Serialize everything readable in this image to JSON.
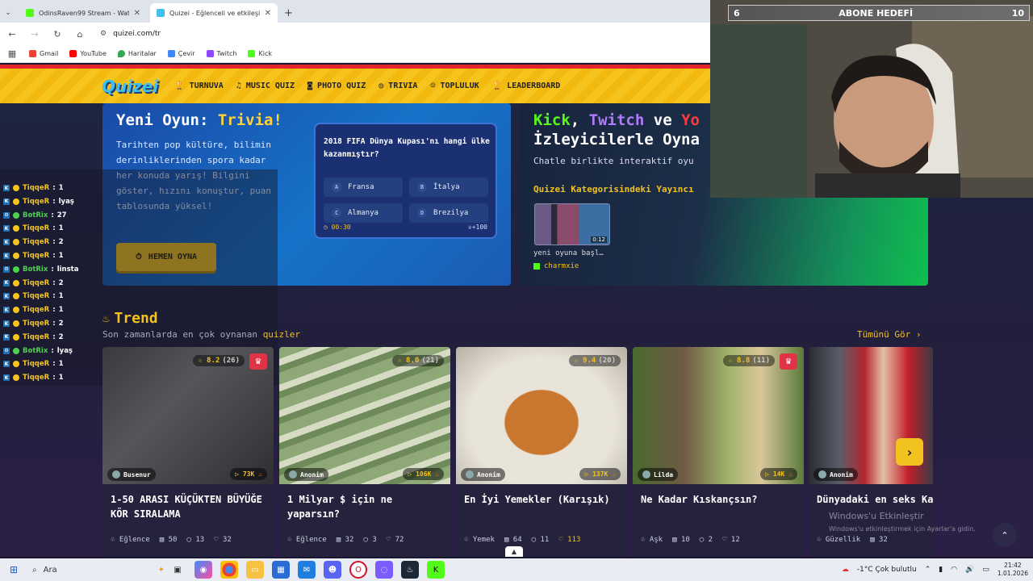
{
  "browser": {
    "tabs": [
      {
        "title": "OdinsRaven99 Stream - Watch",
        "favicon_color": "#53fc18",
        "active": false
      },
      {
        "title": "Quizei - Eğlenceli ve etkileşimli",
        "favicon_color": "#3ec1f0",
        "active": true
      }
    ],
    "url": "quizei.com/tr",
    "bookmarks": [
      {
        "label": "Gmail",
        "color": "#ea4335"
      },
      {
        "label": "YouTube",
        "color": "#ff0000"
      },
      {
        "label": "Haritalar",
        "color": "#34a853"
      },
      {
        "label": "Çevir",
        "color": "#4285f4"
      },
      {
        "label": "Twitch",
        "color": "#9146ff"
      },
      {
        "label": "Kick",
        "color": "#53fc18"
      }
    ]
  },
  "site": {
    "logo": "Quizei",
    "nav": [
      {
        "label": "TURNUVA",
        "icon": "trophy-icon"
      },
      {
        "label": "MUSIC QUIZ",
        "icon": "music-icon"
      },
      {
        "label": "PHOTO QUIZ",
        "icon": "camera-icon"
      },
      {
        "label": "TRIVIA",
        "icon": "chat-icon"
      },
      {
        "label": "TOPLULUK",
        "icon": "users-icon"
      },
      {
        "label": "LEADERBOARD",
        "icon": "trophy-icon"
      }
    ]
  },
  "hero_trivia": {
    "title_prefix": "Yeni Oyun:",
    "title_highlight": "Trivia!",
    "description": "Tarihten pop kültüre, bilimin derinliklerinden spora kadar her konuda yarış! Bilgini göster, hızını konuştur, puan tablosunda yüksel!",
    "play_button": "HEMEN OYNA",
    "question": "2018 FIFA Dünya Kupası'nı hangi ülke kazanmıştır?",
    "options": [
      {
        "key": "A",
        "label": "Fransa"
      },
      {
        "key": "B",
        "label": "İtalya"
      },
      {
        "key": "C",
        "label": "Almanya"
      },
      {
        "key": "D",
        "label": "Brezilya"
      }
    ],
    "timer": "00:30",
    "points": "+100"
  },
  "hero_stream": {
    "line1_kick": "Kick",
    "line1_sep1": ",",
    "line1_twitch": "Twitch",
    "line1_ve": "ve",
    "line1_yo": "Yo",
    "line2": "İzleyicilerle Oyna",
    "subtitle": "Chatle birlikte interaktif oyu",
    "category_title": "Quizei Kategorisindeki Yayıncı",
    "video_title": "yeni oyuna başl…",
    "video_duration": "0:12",
    "channel": "charmxie",
    "colors": {
      "kick": "#53fc18",
      "twitch": "#b07aff",
      "youtube": "#ff3b3b"
    }
  },
  "chat": [
    {
      "platform": "kick",
      "name": "TiqqeR",
      "msg": "1"
    },
    {
      "platform": "kick",
      "name": "TiqqeR",
      "msg": "lyaş"
    },
    {
      "platform": "bot",
      "name": "BotRix",
      "msg": "27"
    },
    {
      "platform": "kick",
      "name": "TiqqeR",
      "msg": "1"
    },
    {
      "platform": "kick",
      "name": "TiqqeR",
      "msg": "2"
    },
    {
      "platform": "kick",
      "name": "TiqqeR",
      "msg": "1"
    },
    {
      "platform": "bot",
      "name": "BotRix",
      "msg": "linsta"
    },
    {
      "platform": "kick",
      "name": "TiqqeR",
      "msg": "2"
    },
    {
      "platform": "kick",
      "name": "TiqqeR",
      "msg": "1"
    },
    {
      "platform": "kick",
      "name": "TiqqeR",
      "msg": "1"
    },
    {
      "platform": "kick",
      "name": "TiqqeR",
      "msg": "2"
    },
    {
      "platform": "kick",
      "name": "TiqqeR",
      "msg": "2"
    },
    {
      "platform": "bot",
      "name": "BotRix",
      "msg": "lyaş"
    },
    {
      "platform": "kick",
      "name": "TiqqeR",
      "msg": "1"
    },
    {
      "platform": "kick",
      "name": "TiqqeR",
      "msg": "1"
    }
  ],
  "trend": {
    "title": "Trend",
    "subtitle_prefix": "Son zamanlarda en çok oynanan",
    "subtitle_highlight": "quizler",
    "see_all": "Tümünü Gör ›",
    "cards": [
      {
        "rating": "8.2",
        "votes": "(26)",
        "crown": true,
        "author": "Busenur",
        "plays": "73K",
        "title": "1-50 ARASI KÜÇÜKTEN BÜYÜĞE KÖR SIRALAMA",
        "category": "Eğlence",
        "questions": "50",
        "comments": "13",
        "likes": "32",
        "liked": false,
        "bg": "linear-gradient(135deg,#3a3a3e,#55555a 40%,#2f2f33)"
      },
      {
        "rating": "8.0",
        "votes": "(21)",
        "crown": false,
        "author": "Anonim",
        "plays": "106K",
        "title": "1 Milyar $ için ne yaparsın?",
        "category": "Eğlence",
        "questions": "32",
        "comments": "3",
        "likes": "72",
        "liked": false,
        "bg": "repeating-linear-gradient(160deg,#8fa878 0 14px,#d6dcc4 14px 22px,#6f8a5a 22px 30px)"
      },
      {
        "rating": "9.4",
        "votes": "(20)",
        "crown": false,
        "author": "Anonim",
        "plays": "137K",
        "title": "En İyi Yemekler (Karışık)",
        "category": "Yemek",
        "questions": "64",
        "comments": "11",
        "likes": "113",
        "liked": true,
        "bg": "radial-gradient(ellipse at 50% 55%,#c9772e 0 30%,#e9e4da 31% 60%,#b7b0a4 100%)"
      },
      {
        "rating": "8.8",
        "votes": "(11)",
        "crown": true,
        "author": "Lilda",
        "plays": "14K",
        "title": "Ne Kadar Kıskançsın?",
        "category": "Aşk",
        "questions": "10",
        "comments": "2",
        "likes": "12",
        "liked": false,
        "bg": "linear-gradient(90deg,#4a6a2f 0%,#6f5a45 30%,#9fb26a 55%,#d9c79a 75%,#5a7a3a 100%)"
      },
      {
        "rating": "",
        "votes": "",
        "crown": false,
        "author": "Anonim",
        "plays": "",
        "title": "Dünyadaki en seks Kadın kim",
        "category": "Güzellik",
        "questions": "32",
        "comments": "",
        "likes": "",
        "liked": false,
        "bg": "linear-gradient(90deg,#2b2b33 0%,#5a5e6a 25%,#b4262e 45%,#e3c1a8 60%,#c3202a 80%,#3a3a44 100%)"
      }
    ]
  },
  "webcam": {
    "goal_current": "6",
    "goal_label": "ABONE HEDEFİ",
    "goal_target": "10"
  },
  "windows": {
    "watermark_line1": "Windows'u Etkinleştir",
    "watermark_line2": "Windows'u etkinleştirmek için Ayarlar'a gidin.",
    "search_placeholder": "Ara",
    "weather": "-1°C  Çok bulutlu",
    "time": "21:42",
    "date": "1.01.2026"
  }
}
